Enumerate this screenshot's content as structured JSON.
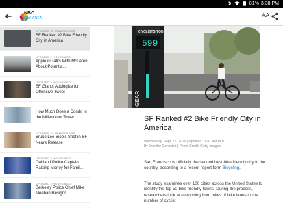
{
  "status_bar": {
    "battery": "81%",
    "time": "3:38 PM"
  },
  "app_bar": {
    "logo_top": "NBC",
    "logo_bottom": "BAY AREA",
    "text_size_label": "AA"
  },
  "sidebar": {
    "items": [
      {
        "meta": "Updated 33 minutes ago",
        "title": "SF Ranked #2 Bike Friendly City in America",
        "thumb": "#4f5358",
        "active": true
      },
      {
        "meta": "Updated 2 hours ago",
        "title": "Apple in Talks With McLaren About Potentia...",
        "thumb": "#8d8d8d"
      },
      {
        "meta": "Updated 2 hours ago",
        "title": "SF Giants Apologize for Offensive Tweet",
        "thumb": "#3b3b3b"
      },
      {
        "meta": "",
        "title": "How Much Does a Condo in the Millennium Tower...",
        "thumb": "#9ab0c4"
      },
      {
        "meta": "Updated 10 minutes ago",
        "title": "Bruce Lee Biopic Shot in SF Nears Release",
        "thumb": "#b49a82"
      },
      {
        "meta": "Updated 2 hours ago",
        "title": "Oakland Police Captain Raising Money for Famil...",
        "thumb": "#2e56a8"
      },
      {
        "meta": "Updated 3 hours ago",
        "title": "Berkeley Police Chief Mike Meehan Resigns",
        "thumb": "#3f5f8a"
      }
    ]
  },
  "article": {
    "hero_sign": "CYCLISTS TODAY",
    "hero_number": "599",
    "hero_gear": "GEAR",
    "headline": "SF Ranked #2 Bike Friendly City in America",
    "byline_date": "Wednesday, Sept. 21, 2016 | Updated 11:47 AM PDT",
    "byline_author": "By Jennifer Gonzalez | Photo Credit: Getty Images",
    "para1_text": "San Francisco is officially the second best bike friendly city in the country, according to a recent report form ",
    "para1_link": "Bicycling",
    "para1_end": ".",
    "para2": "The study examines over 100 cities across the United States to identify the top 50 bike-friendly towns. During the process, researchers look at everything from miles of bike lanes to the number of cyclist"
  }
}
